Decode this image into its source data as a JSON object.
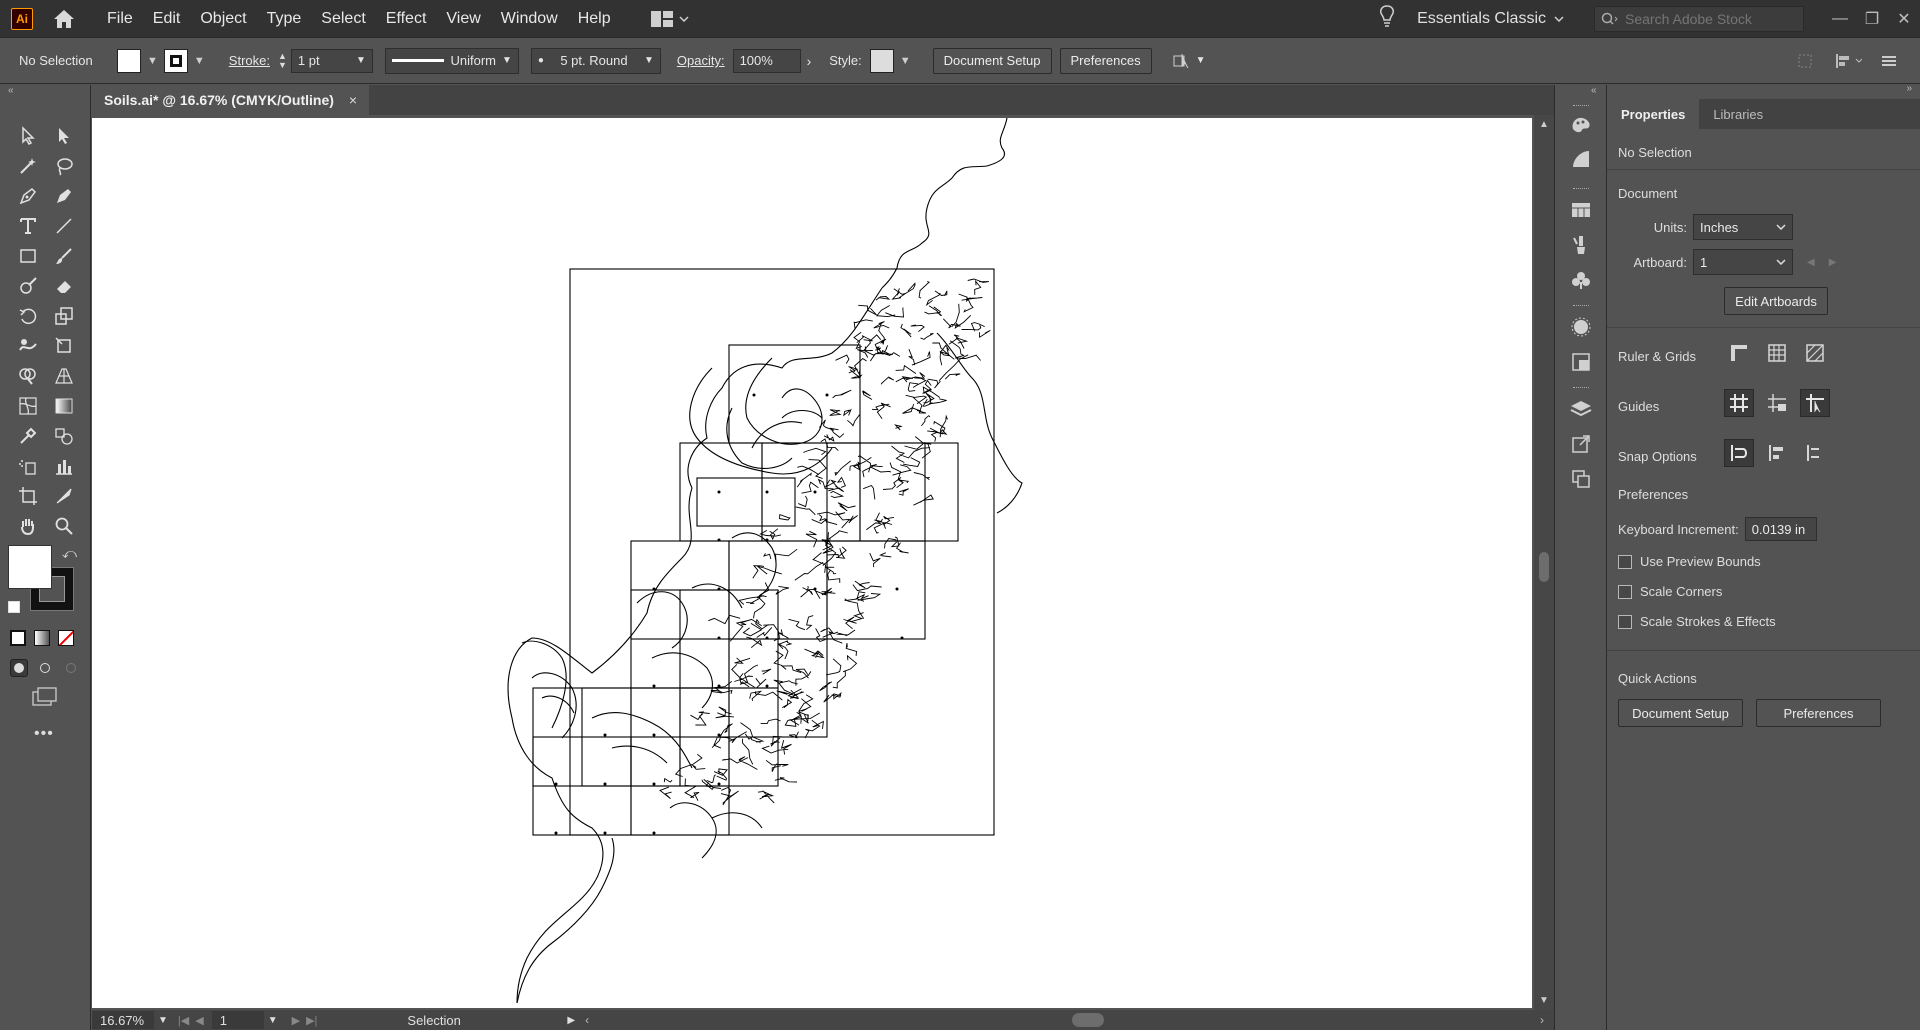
{
  "app": {
    "logo": "Ai",
    "menus": [
      "File",
      "Edit",
      "Object",
      "Type",
      "Select",
      "Effect",
      "View",
      "Window",
      "Help"
    ],
    "workspace": "Essentials Classic",
    "stock_search_placeholder": "Search Adobe Stock",
    "window_controls": [
      "—",
      "❐",
      "✕"
    ]
  },
  "control_bar": {
    "selection": "No Selection",
    "stroke_label": "Stroke:",
    "stroke_weight": "1 pt",
    "profile": "Uniform",
    "brush": "5 pt. Round",
    "opacity_label": "Opacity:",
    "opacity": "100%",
    "style_label": "Style:",
    "doc_setup": "Document Setup",
    "preferences": "Preferences"
  },
  "document": {
    "tab_title": "Soils.ai* @ 16.67% (CMYK/Outline)",
    "close": "×"
  },
  "status": {
    "zoom": "16.67%",
    "artboard": "1",
    "tool": "Selection"
  },
  "panel": {
    "tabs": [
      "Properties",
      "Libraries"
    ],
    "selection": "No Selection",
    "document_title": "Document",
    "units_label": "Units:",
    "units": "Inches",
    "artboard_label": "Artboard:",
    "artboard": "1",
    "edit_artboards": "Edit Artboards",
    "ruler_grids": "Ruler & Grids",
    "guides": "Guides",
    "snap_options": "Snap Options",
    "preferences_title": "Preferences",
    "keyboard_increment_label": "Keyboard Increment:",
    "keyboard_increment": "0.0139 in",
    "checkboxes": [
      "Use Preview Bounds",
      "Scale Corners",
      "Scale Strokes & Effects"
    ],
    "quick_actions": "Quick Actions",
    "qa_doc_setup": "Document Setup",
    "qa_preferences": "Preferences"
  },
  "colors": {
    "ui_bg": "#535353",
    "menubar": "#323232",
    "logo_accent": "#ff9a00",
    "artboard": "#ffffff"
  }
}
